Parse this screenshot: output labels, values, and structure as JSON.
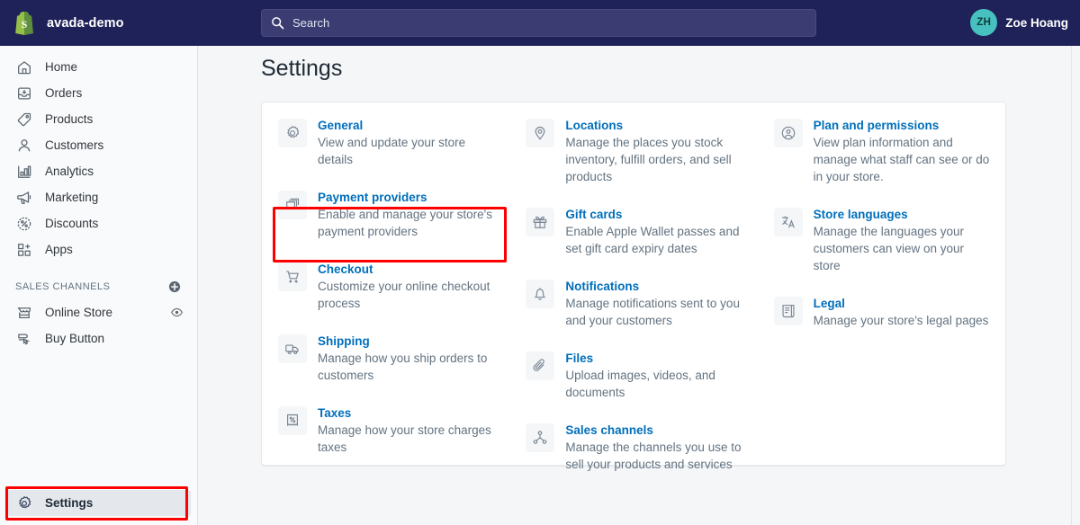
{
  "topbar": {
    "logo_icon": "shopify-bag-icon",
    "store_name": "avada-demo",
    "search": {
      "placeholder": "Search",
      "icon": "search-icon"
    },
    "user": {
      "initials": "ZH",
      "name": "Zoe Hoang"
    },
    "colors": {
      "bar_bg": "#1f2259",
      "search_bg": "#3a3c72",
      "avatar_bg": "#47c1bf",
      "logo_green": "#95bf47"
    }
  },
  "sidebar": {
    "items": [
      {
        "label": "Home",
        "icon": "home-icon"
      },
      {
        "label": "Orders",
        "icon": "orders-inbox-icon"
      },
      {
        "label": "Products",
        "icon": "tag-icon"
      },
      {
        "label": "Customers",
        "icon": "person-icon"
      },
      {
        "label": "Analytics",
        "icon": "bar-chart-icon"
      },
      {
        "label": "Marketing",
        "icon": "megaphone-icon"
      },
      {
        "label": "Discounts",
        "icon": "percent-circle-icon"
      },
      {
        "label": "Apps",
        "icon": "apps-grid-icon"
      }
    ],
    "section": {
      "title": "SALES CHANNELS",
      "add_icon": "plus-circle-icon",
      "channels": [
        {
          "label": "Online Store",
          "icon": "storefront-icon",
          "trailing_icon": "eye-icon"
        },
        {
          "label": "Buy Button",
          "icon": "buy-button-icon",
          "trailing_icon": ""
        }
      ]
    },
    "settings": {
      "label": "Settings",
      "icon": "gear-icon",
      "active": true
    }
  },
  "main": {
    "page_title": "Settings",
    "columns": [
      [
        {
          "title": "General",
          "desc": "View and update your store details",
          "icon": "gear-icon"
        },
        {
          "title": "Payment providers",
          "desc": "Enable and manage your store's payment providers",
          "icon": "payment-card-icon"
        },
        {
          "title": "Checkout",
          "desc": "Customize your online checkout process",
          "icon": "cart-icon"
        },
        {
          "title": "Shipping",
          "desc": "Manage how you ship orders to customers",
          "icon": "truck-icon"
        },
        {
          "title": "Taxes",
          "desc": "Manage how your store charges taxes",
          "icon": "tax-receipt-icon"
        }
      ],
      [
        {
          "title": "Locations",
          "desc": "Manage the places you stock inventory, fulfill orders, and sell products",
          "icon": "map-pin-icon"
        },
        {
          "title": "Gift cards",
          "desc": "Enable Apple Wallet passes and set gift card expiry dates",
          "icon": "gift-icon"
        },
        {
          "title": "Notifications",
          "desc": "Manage notifications sent to you and your customers",
          "icon": "bell-icon"
        },
        {
          "title": "Files",
          "desc": "Upload images, videos, and documents",
          "icon": "paperclip-icon"
        },
        {
          "title": "Sales channels",
          "desc": "Manage the channels you use to sell your products and services",
          "icon": "network-nodes-icon"
        }
      ],
      [
        {
          "title": "Plan and permissions",
          "desc": "View plan information and manage what staff can see or do in your store.",
          "icon": "person-circle-icon"
        },
        {
          "title": "Store languages",
          "desc": "Manage the languages your customers can view on your store",
          "icon": "translate-icon"
        },
        {
          "title": "Legal",
          "desc": "Manage your store's legal pages",
          "icon": "scroll-document-icon"
        }
      ]
    ]
  },
  "annotations": {
    "color": "#ff0000",
    "boxes": [
      {
        "target": "payment-providers-setting"
      },
      {
        "target": "sidebar-item-settings"
      }
    ]
  }
}
